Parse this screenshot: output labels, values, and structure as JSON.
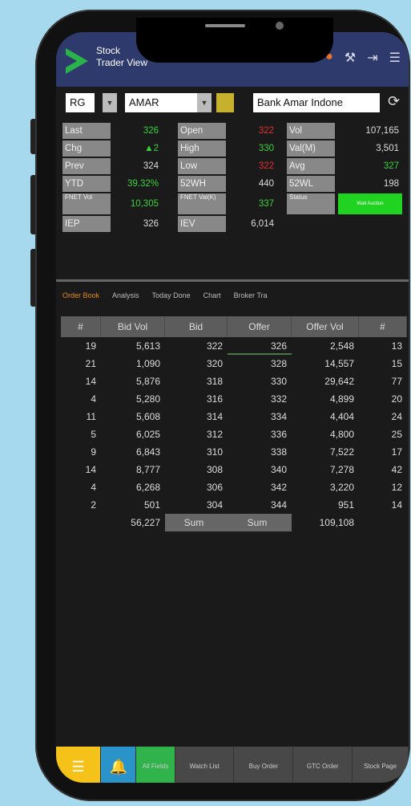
{
  "header": {
    "title_line1": "Stock",
    "title_line2": "Trader View"
  },
  "selectors": {
    "board": "RG",
    "stock": "AMAR",
    "company": "Bank Amar Indone"
  },
  "quote": {
    "rows": [
      [
        {
          "l": "Last",
          "v": "326",
          "c": "green"
        },
        {
          "l": "Open",
          "v": "322",
          "c": "red"
        },
        {
          "l": "Vol",
          "v": "107,165",
          "c": ""
        }
      ],
      [
        {
          "l": "Chg",
          "v": "▲2",
          "c": "green"
        },
        {
          "l": "High",
          "v": "330",
          "c": "green"
        },
        {
          "l": "Val(M)",
          "v": "3,501",
          "c": ""
        }
      ],
      [
        {
          "l": "Prev",
          "v": "324",
          "c": ""
        },
        {
          "l": "Low",
          "v": "322",
          "c": "red"
        },
        {
          "l": "Avg",
          "v": "327",
          "c": "green"
        }
      ],
      [
        {
          "l": "YTD",
          "v": "39.32%",
          "c": "green"
        },
        {
          "l": "52WH",
          "v": "440",
          "c": ""
        },
        {
          "l": "52WL",
          "v": "198",
          "c": ""
        }
      ],
      [
        {
          "l": "FNET Vol",
          "v": "10,305",
          "c": "green"
        },
        {
          "l": "FNET Val(K)",
          "v": "337",
          "c": "green"
        },
        {
          "l": "Status",
          "v": "Wait Auction",
          "c": "badge"
        }
      ],
      [
        {
          "l": "IEP",
          "v": "326",
          "c": ""
        },
        {
          "l": "IEV",
          "v": "6,014",
          "c": ""
        }
      ]
    ]
  },
  "tabs": [
    "Order Book",
    "Analysis",
    "Today Done",
    "Chart",
    "Broker Tra"
  ],
  "orderbook": {
    "headers": [
      "#",
      "Bid Vol",
      "Bid",
      "Offer",
      "Offer Vol",
      "#"
    ],
    "rows": [
      [
        "19",
        "5,613",
        "322",
        "326",
        "2,548",
        "13"
      ],
      [
        "21",
        "1,090",
        "320",
        "328",
        "14,557",
        "15"
      ],
      [
        "14",
        "5,876",
        "318",
        "330",
        "29,642",
        "77"
      ],
      [
        "4",
        "5,280",
        "316",
        "332",
        "4,899",
        "20"
      ],
      [
        "11",
        "5,608",
        "314",
        "334",
        "4,404",
        "24"
      ],
      [
        "5",
        "6,025",
        "312",
        "336",
        "4,800",
        "25"
      ],
      [
        "9",
        "6,843",
        "310",
        "338",
        "7,522",
        "17"
      ],
      [
        "14",
        "8,777",
        "308",
        "340",
        "7,278",
        "42"
      ],
      [
        "4",
        "6,268",
        "306",
        "342",
        "3,220",
        "12"
      ],
      [
        "2",
        "501",
        "304",
        "344",
        "951",
        "14"
      ]
    ],
    "sum_bid_vol": "56,227",
    "sum_label_bid": "Sum",
    "sum_label_offer": "Sum",
    "sum_offer_vol": "109,108"
  },
  "bottom": [
    {
      "label": "",
      "icon": "menu-icon",
      "color": "#f5c21a"
    },
    {
      "label": "",
      "icon": "notification-icon",
      "color": "#2a93c9"
    },
    {
      "label": "All Fields",
      "icon": "",
      "color": "#2fb34a"
    },
    {
      "label": "Watch List",
      "icon": "",
      "color": "#484848"
    },
    {
      "label": "Buy Order",
      "icon": "",
      "color": "#484848"
    },
    {
      "label": "GTC Order",
      "icon": "",
      "color": "#484848"
    },
    {
      "label": "Stock Page",
      "icon": "",
      "color": "#484848"
    }
  ],
  "colors": {
    "header": "#2e3a6b",
    "green": "#3cd23c",
    "red": "#e03030",
    "accent": "#e68a1f"
  }
}
